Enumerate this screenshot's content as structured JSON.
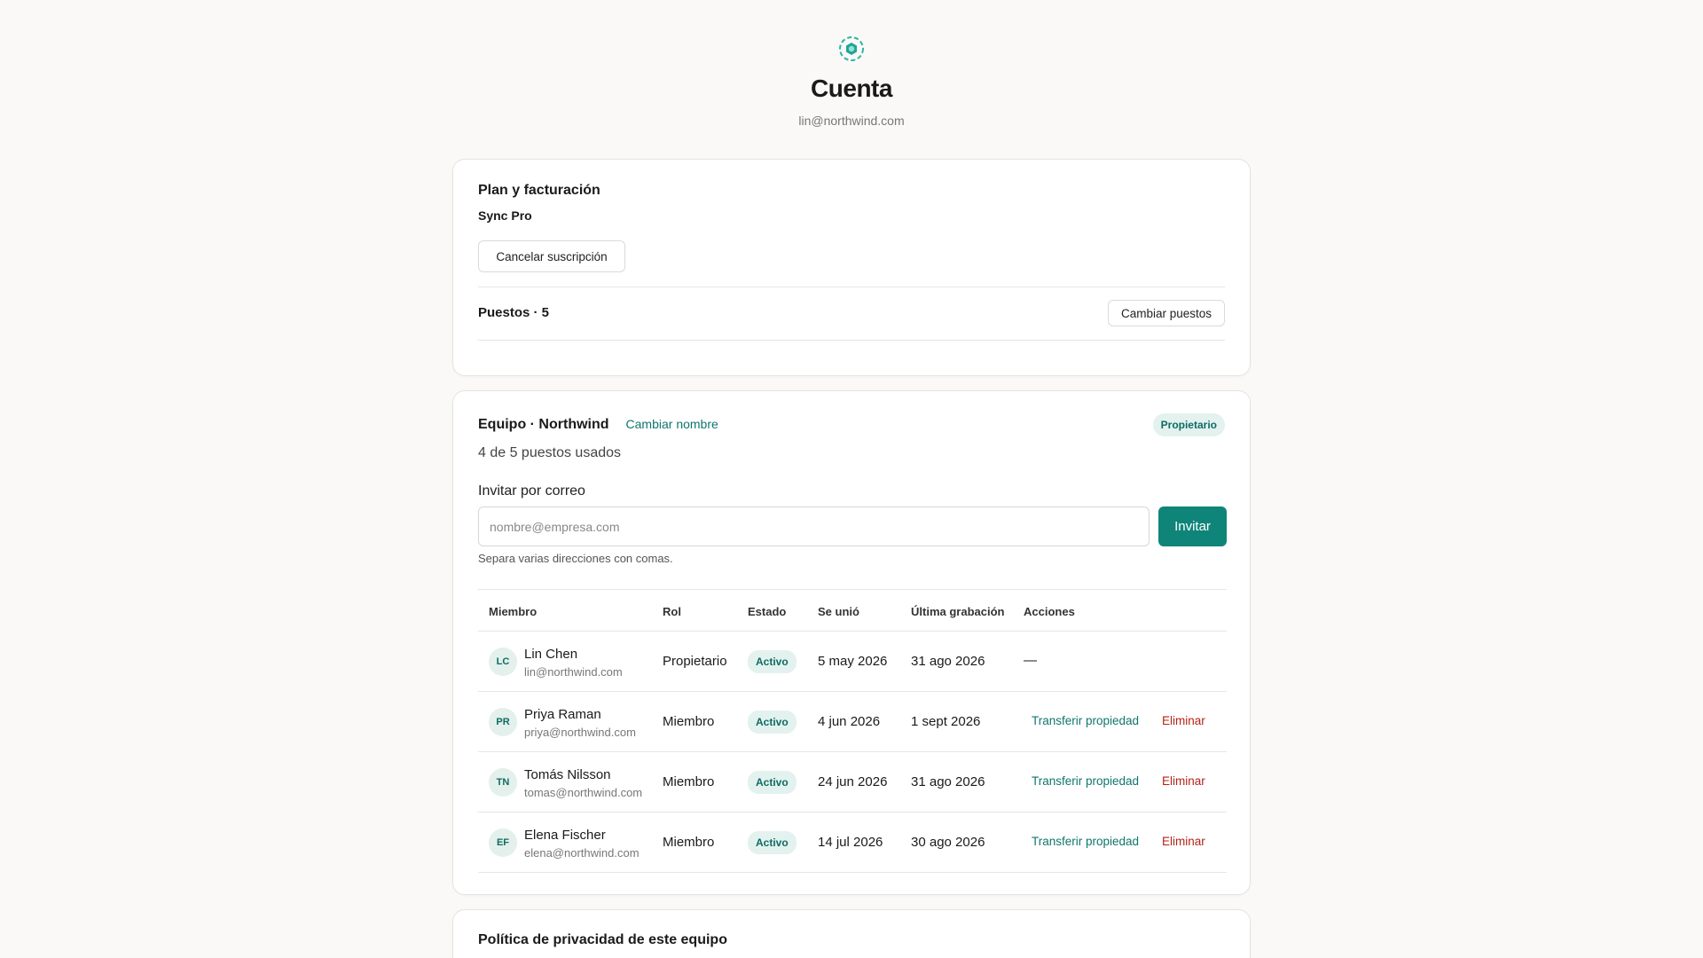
{
  "header": {
    "logo_icon": "sync-logo-icon",
    "title": "Cuenta",
    "email": "lin@northwind.com"
  },
  "billing": {
    "title": "Plan y facturación",
    "plan_name": "Sync Pro",
    "cancel_label": "Cancelar suscripción",
    "seats_label": "Puestos · 5",
    "change_seats_label": "Cambiar puestos"
  },
  "team": {
    "title": "Equipo · Northwind",
    "rename_label": "Cambiar nombre",
    "role_badge": "Propietario",
    "usage": "4 de 5 puestos usados",
    "invite_label": "Invitar por correo",
    "invite_placeholder": "nombre@empresa.com",
    "invite_value": "",
    "invite_button": "Invitar",
    "hint": "Separa varias direcciones con comas.",
    "columns": [
      "Miembro",
      "Rol",
      "Estado",
      "Se unió",
      "Última grabación",
      "Acciones"
    ],
    "members": [
      {
        "initials": "LC",
        "name": "Lin Chen",
        "email": "lin@northwind.com",
        "role": "Propietario",
        "status": "Activo",
        "joined": "5 may 2026",
        "last": "31 ago 2026",
        "actions_none": "—"
      },
      {
        "initials": "PR",
        "name": "Priya Raman",
        "email": "priya@northwind.com",
        "role": "Miembro",
        "status": "Activo",
        "joined": "4 jun 2026",
        "last": "1 sept 2026",
        "transfer": "Transferir propiedad",
        "remove": "Eliminar"
      },
      {
        "initials": "TN",
        "name": "Tomás Nilsson",
        "email": "tomas@northwind.com",
        "role": "Miembro",
        "status": "Activo",
        "joined": "24 jun 2026",
        "last": "31 ago 2026",
        "transfer": "Transferir propiedad",
        "remove": "Eliminar"
      },
      {
        "initials": "EF",
        "name": "Elena Fischer",
        "email": "elena@northwind.com",
        "role": "Miembro",
        "status": "Activo",
        "joined": "14 jul 2026",
        "last": "30 ago 2026",
        "transfer": "Transferir propiedad",
        "remove": "Eliminar"
      }
    ]
  },
  "privacy": {
    "title": "Política de privacidad de este equipo"
  },
  "colors": {
    "accent": "#0f857a",
    "danger": "#b42318",
    "background": "#faf9f7"
  }
}
